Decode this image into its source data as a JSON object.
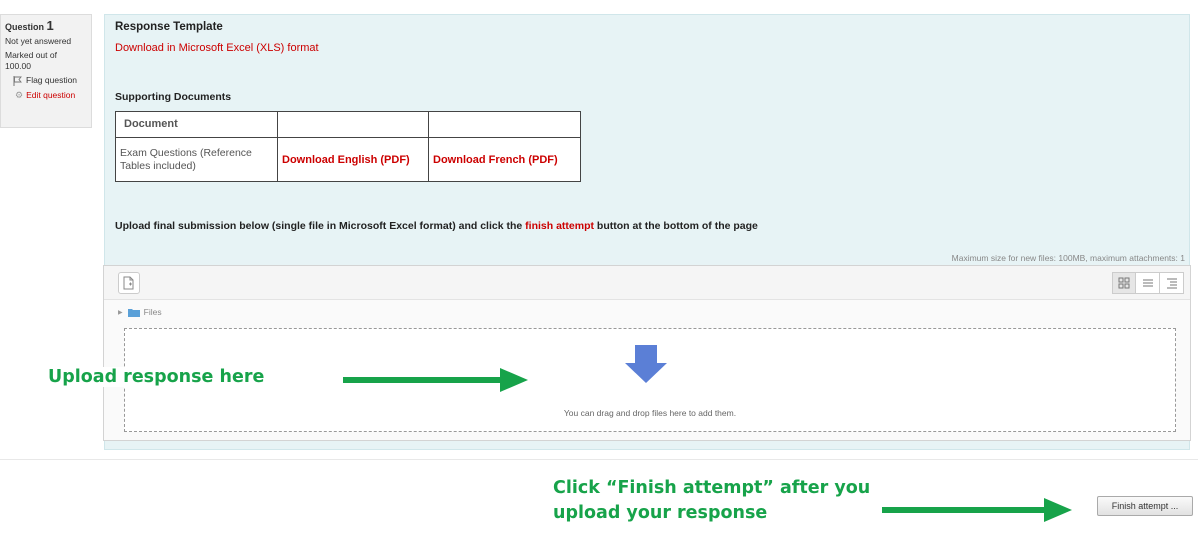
{
  "question_info": {
    "question_label": "Question",
    "question_number": "1",
    "state": "Not yet answered",
    "grade": "Marked out of 100.00",
    "flag_label": "Flag question",
    "edit_label": "Edit question"
  },
  "content": {
    "template_heading": "Response Template",
    "template_link": "Download in Microsoft Excel (XLS) format",
    "supporting_heading": "Supporting Documents",
    "table": {
      "header": [
        "Document",
        "",
        ""
      ],
      "rows": [
        {
          "document": "Exam Questions (Reference Tables included)",
          "english_link": "Download English (PDF)",
          "french_link": "Download French (PDF)"
        }
      ]
    },
    "instruction_before": "Upload final submission below (single file in Microsoft Excel format) and click the ",
    "instruction_highlight": "finish attempt",
    "instruction_after": " button at the bottom of the page"
  },
  "filemanager": {
    "max_size_text": "Maximum size for new files: 100MB, maximum attachments: 1",
    "path_label": "Files",
    "drop_text": "You can drag and drop files here to add them.",
    "icons": [
      "add-file-icon",
      "icon-view-icon",
      "list-view-icon",
      "tree-view-icon",
      "folder-icon",
      "download-arrow-icon"
    ]
  },
  "annotations": {
    "upload_label": "Upload response here",
    "finish_label": "Click “Finish attempt” after you upload your response",
    "color": "#17a34a"
  },
  "finish_button": "Finish attempt ...",
  "colors": {
    "link_red": "#cc0000",
    "panel_bg": "#e7f3f5",
    "arrow_blue": "#5b7fd6"
  }
}
